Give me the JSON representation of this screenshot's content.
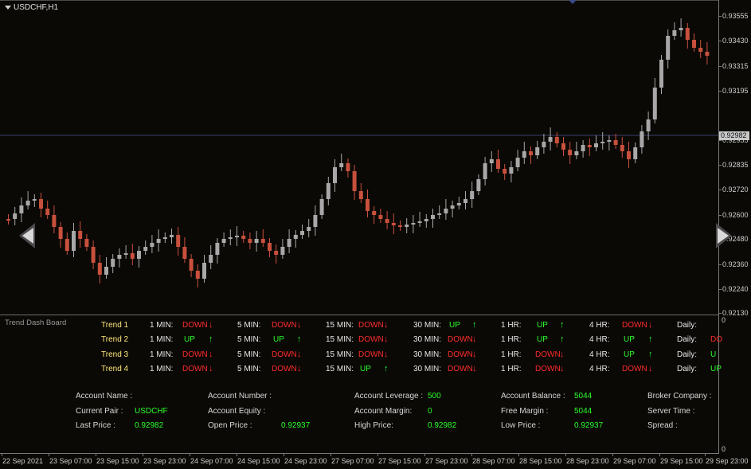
{
  "chart": {
    "symbol_title": "USDCHF,H1",
    "current_price": "0.92982",
    "price_labels": [
      "0.93555",
      "0.93430",
      "0.93315",
      "0.93195",
      "0.92955",
      "0.92835",
      "0.92720",
      "0.92600",
      "0.92480",
      "0.92360",
      "0.92240",
      "0.92130"
    ],
    "time_labels": [
      "22 Sep 2021",
      "23 Sep 07:00",
      "23 Sep 15:00",
      "23 Sep 23:00",
      "24 Sep 07:00",
      "24 Sep 15:00",
      "24 Sep 23:00",
      "27 Sep 07:00",
      "27 Sep 15:00",
      "27 Sep 23:00",
      "28 Sep 07:00",
      "28 Sep 15:00",
      "28 Sep 23:00",
      "29 Sep 07:00",
      "29 Sep 15:00",
      "29 Sep 23:00"
    ],
    "subwindow_axis_top": "0",
    "subwindow_axis_bottom": "0",
    "colors": {
      "bull": "#a8a8a8",
      "bear": "#c8503c",
      "background": "#0b0906",
      "price_line": "#3a3f6a"
    },
    "nav_left_icon": "left-arrow-icon",
    "nav_right_icon": "right-arrow-icon"
  },
  "dashboard": {
    "title": "Trend Dash Board",
    "trends": [
      {
        "name": "Trend 1",
        "cells": [
          {
            "tf": "1 MIN:",
            "status": "DOWN",
            "dir": "down"
          },
          {
            "tf": "5 MIN:",
            "status": "DOWN",
            "dir": "down"
          },
          {
            "tf": "15 MIN:",
            "status": "DOWN",
            "dir": "down"
          },
          {
            "tf": "30 MIN:",
            "status": "UP",
            "dir": "up"
          },
          {
            "tf": "1 HR:",
            "status": "UP",
            "dir": "up"
          },
          {
            "tf": "4 HR:",
            "status": "DOWN",
            "dir": "down"
          },
          {
            "tf": "Daily:",
            "status": "",
            "dir": ""
          }
        ]
      },
      {
        "name": "Trend 2",
        "cells": [
          {
            "tf": "1 MIN:",
            "status": "UP",
            "dir": "up"
          },
          {
            "tf": "5 MIN:",
            "status": "UP",
            "dir": "up"
          },
          {
            "tf": "15 MIN:",
            "status": "DOWN",
            "dir": "down"
          },
          {
            "tf": "30 MIN:",
            "status": "DOWN",
            "dir": "down"
          },
          {
            "tf": "1 HR:",
            "status": "UP",
            "dir": "up"
          },
          {
            "tf": "4 HR:",
            "status": "UP",
            "dir": "up"
          },
          {
            "tf": "Daily:",
            "status": "DO",
            "dir": "cut-down"
          }
        ]
      },
      {
        "name": "Trend 3",
        "cells": [
          {
            "tf": "1 MIN:",
            "status": "DOWN",
            "dir": "down"
          },
          {
            "tf": "5 MIN:",
            "status": "DOWN",
            "dir": "down"
          },
          {
            "tf": "15 MIN:",
            "status": "DOWN",
            "dir": "down"
          },
          {
            "tf": "30 MIN:",
            "status": "DOWN",
            "dir": "down"
          },
          {
            "tf": "1 HR:",
            "status": "DOWN",
            "dir": "down"
          },
          {
            "tf": "4 HR:",
            "status": "UP",
            "dir": "up"
          },
          {
            "tf": "Daily:",
            "status": "U",
            "dir": "cut-up"
          }
        ]
      },
      {
        "name": "Trend 4",
        "cells": [
          {
            "tf": "1 MIN:",
            "status": "DOWN",
            "dir": "down"
          },
          {
            "tf": "5 MIN:",
            "status": "DOWN",
            "dir": "down"
          },
          {
            "tf": "15 MIN:",
            "status": "UP",
            "dir": "up"
          },
          {
            "tf": "30 MIN:",
            "status": "DOWN",
            "dir": "down"
          },
          {
            "tf": "1 HR:",
            "status": "DOWN",
            "dir": "down"
          },
          {
            "tf": "4 HR:",
            "status": "DOWN",
            "dir": "down"
          },
          {
            "tf": "Daily:",
            "status": "UP",
            "dir": "cut-up"
          }
        ]
      }
    ]
  },
  "account": {
    "rows": [
      [
        {
          "label": "Account Name :",
          "value": ""
        },
        {
          "label": "Account Number :",
          "value": ""
        },
        {
          "label": "Account Leverage :",
          "value": "500"
        },
        {
          "label": "Account Balance :",
          "value": "5044"
        },
        {
          "label": "Broker Company :",
          "value": ""
        }
      ],
      [
        {
          "label": "Current Pair :",
          "value": "USDCHF"
        },
        {
          "label": "Account Equity :",
          "value": ""
        },
        {
          "label": "Account Margin:",
          "value": "0"
        },
        {
          "label": "Free Margin :",
          "value": "5044"
        },
        {
          "label": "Server Time :",
          "value": ""
        }
      ],
      [
        {
          "label": "Last Price :",
          "value": "0.92982"
        },
        {
          "label": "Open Price :",
          "value": "0.92937"
        },
        {
          "label": "High Price:",
          "value": "0.92982"
        },
        {
          "label": "Low Price :",
          "value": "0.92937"
        },
        {
          "label": "Spread :",
          "value": ""
        }
      ]
    ]
  }
}
